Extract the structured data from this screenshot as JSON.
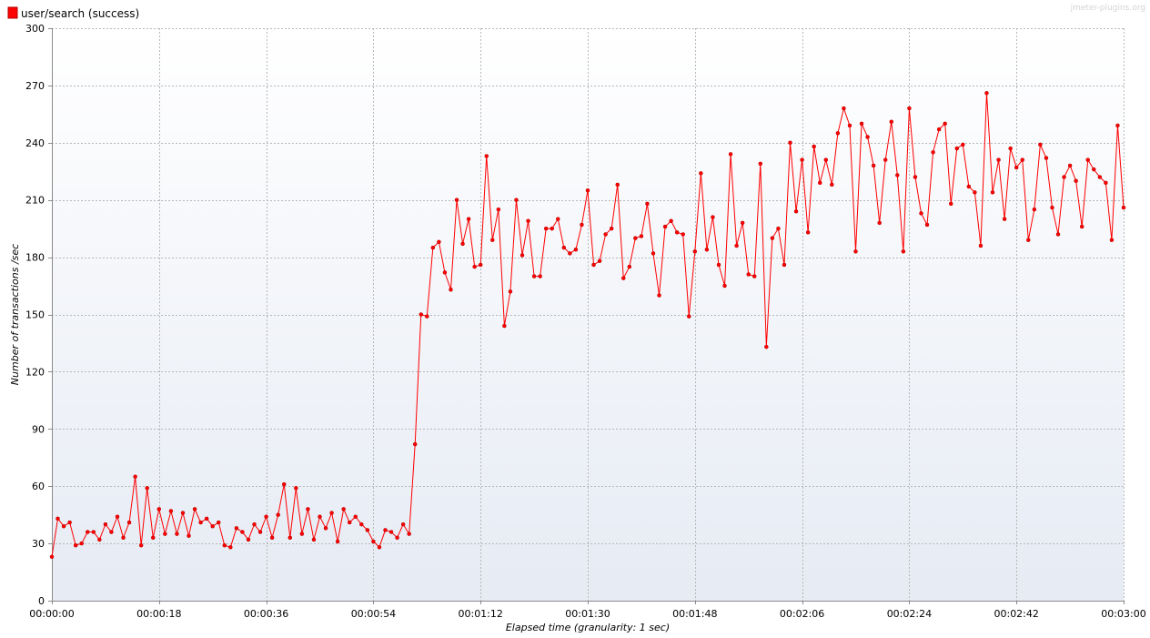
{
  "chart_data": {
    "type": "line",
    "xlabel": "Elapsed time (granularity: 1 sec)",
    "ylabel": "Number of transactions /sec",
    "watermark": "jmeter-plugins.org",
    "legend_position": "top-left",
    "grid": true,
    "x_unit": "seconds",
    "xlim": [
      0,
      180
    ],
    "ylim": [
      0,
      300
    ],
    "x_tick_labels": [
      "00:00:00",
      "00:00:18",
      "00:00:36",
      "00:00:54",
      "00:01:12",
      "00:01:30",
      "00:01:48",
      "00:02:06",
      "00:02:24",
      "00:02:42",
      "00:03:00"
    ],
    "y_tick_labels": [
      "0",
      "30",
      "60",
      "90",
      "120",
      "150",
      "180",
      "210",
      "240",
      "270",
      "300"
    ],
    "colors": {
      "series": "#ff0000",
      "series_edge": "#b00000",
      "plot_bg_top": "#ffffff",
      "plot_bg_bottom": "#e6ebf4",
      "grid": "#b8b8b8"
    },
    "series": [
      {
        "name": "user/search (success)",
        "x": [
          0,
          1,
          2,
          3,
          4,
          5,
          6,
          7,
          8,
          9,
          10,
          11,
          12,
          13,
          14,
          15,
          16,
          17,
          18,
          19,
          20,
          21,
          22,
          23,
          24,
          25,
          26,
          27,
          28,
          29,
          30,
          31,
          32,
          33,
          34,
          35,
          36,
          37,
          38,
          39,
          40,
          41,
          42,
          43,
          44,
          45,
          46,
          47,
          48,
          49,
          50,
          51,
          52,
          53,
          54,
          55,
          56,
          57,
          58,
          59,
          60,
          61,
          62,
          63,
          64,
          65,
          66,
          67,
          68,
          69,
          70,
          71,
          72,
          73,
          74,
          75,
          76,
          77,
          78,
          79,
          80,
          81,
          82,
          83,
          84,
          85,
          86,
          87,
          88,
          89,
          90,
          91,
          92,
          93,
          94,
          95,
          96,
          97,
          98,
          99,
          100,
          101,
          102,
          103,
          104,
          105,
          106,
          107,
          108,
          109,
          110,
          111,
          112,
          113,
          114,
          115,
          116,
          117,
          118,
          119,
          120,
          121,
          122,
          123,
          124,
          125,
          126,
          127,
          128,
          129,
          130,
          131,
          132,
          133,
          134,
          135,
          136,
          137,
          138,
          139,
          140,
          141,
          142,
          143,
          144,
          145,
          146,
          147,
          148,
          149,
          150,
          151,
          152,
          153,
          154,
          155,
          156,
          157,
          158,
          159,
          160,
          161,
          162,
          163,
          164,
          165,
          166,
          167,
          168,
          169,
          170,
          171,
          172,
          173,
          174,
          175,
          176,
          177,
          178,
          179,
          180
        ],
        "values": [
          23,
          43,
          39,
          41,
          29,
          30,
          36,
          36,
          32,
          40,
          36,
          44,
          33,
          41,
          65,
          29,
          59,
          33,
          48,
          35,
          47,
          35,
          46,
          34,
          48,
          41,
          43,
          39,
          41,
          29,
          28,
          38,
          36,
          32,
          40,
          36,
          44,
          33,
          45,
          61,
          33,
          59,
          35,
          48,
          32,
          44,
          38,
          46,
          31,
          48,
          41,
          44,
          40,
          37,
          31,
          28,
          37,
          36,
          33,
          40,
          35,
          82,
          150,
          149,
          185,
          188,
          172,
          163,
          210,
          187,
          200,
          175,
          176,
          233,
          189,
          205,
          144,
          162,
          210,
          181,
          199,
          170,
          170,
          195,
          195,
          200,
          185,
          182,
          184,
          197,
          215,
          176,
          178,
          192,
          195,
          218,
          169,
          175,
          190,
          191,
          208,
          182,
          160,
          196,
          199,
          193,
          192,
          149,
          183,
          224,
          184,
          201,
          176,
          165,
          234,
          186,
          198,
          171,
          170,
          229,
          133,
          190,
          195,
          176,
          240,
          204,
          231,
          193,
          238,
          219,
          231,
          218,
          245,
          258,
          249,
          183,
          250,
          243,
          228,
          198,
          231,
          251,
          223,
          183,
          258,
          222,
          203,
          197,
          235,
          247,
          250,
          208,
          237,
          239,
          217,
          214,
          186,
          266,
          214,
          231,
          200,
          237,
          227,
          231,
          189,
          205,
          239,
          232,
          206,
          192,
          222,
          228,
          220,
          196,
          231,
          226,
          222,
          219,
          189,
          249,
          206
        ]
      }
    ]
  }
}
